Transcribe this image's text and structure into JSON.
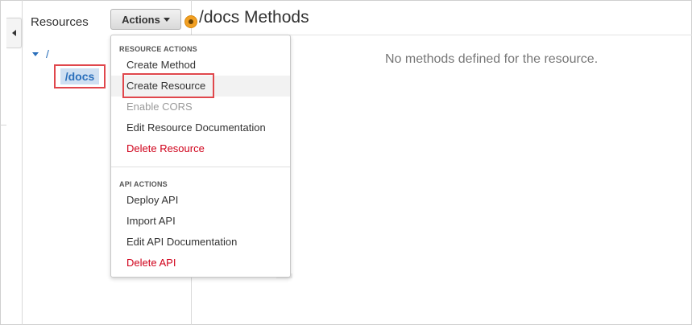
{
  "sidebar": {
    "title": "Resources",
    "tree": {
      "root": "/",
      "selected": "/docs"
    }
  },
  "toolbar": {
    "actions_label": "Actions"
  },
  "header": {
    "title": "/docs Methods"
  },
  "main": {
    "empty_message": "No methods defined for the resource."
  },
  "actions_menu": {
    "resource_section_label": "RESOURCE ACTIONS",
    "resource_items": [
      {
        "label": "Create Method",
        "state": "normal"
      },
      {
        "label": "Create Resource",
        "state": "hover"
      },
      {
        "label": "Enable CORS",
        "state": "disabled"
      },
      {
        "label": "Edit Resource Documentation",
        "state": "normal"
      },
      {
        "label": "Delete Resource",
        "state": "danger"
      }
    ],
    "api_section_label": "API ACTIONS",
    "api_items": [
      {
        "label": "Deploy API",
        "state": "normal"
      },
      {
        "label": "Import API",
        "state": "normal"
      },
      {
        "label": "Edit API Documentation",
        "state": "normal"
      },
      {
        "label": "Delete API",
        "state": "danger"
      }
    ]
  },
  "icons": {
    "collapse": "chevron-left-icon",
    "status": "status-dot-icon",
    "tree_expand": "caret-down-icon",
    "actions_caret": "caret-down-icon"
  },
  "colors": {
    "link": "#2a6fbb",
    "danger": "#d0021b",
    "annotation": "#e0474c",
    "status": "#f2a023"
  }
}
